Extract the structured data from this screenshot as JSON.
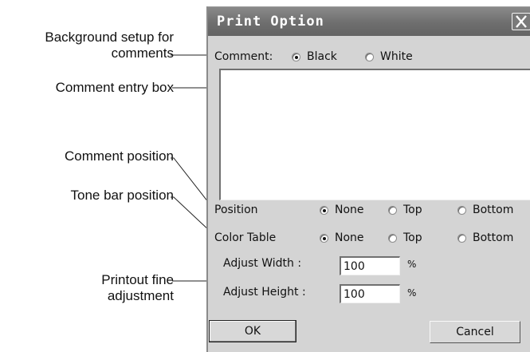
{
  "annotations": {
    "background_setup_line1": "Background setup for",
    "background_setup_line2": "comments",
    "comment_entry_box": "Comment entry box",
    "comment_position": "Comment position",
    "tone_bar_position": "Tone bar position",
    "printout_line1": "Printout fine",
    "printout_line2": "adjustment"
  },
  "dialog": {
    "title": "Print Option",
    "comment": {
      "label": "Comment:",
      "options": [
        "Black",
        "White"
      ],
      "selected": "Black",
      "text": ""
    },
    "position": {
      "label": "Position",
      "options": [
        "None",
        "Top",
        "Bottom"
      ],
      "selected": "None"
    },
    "color_table": {
      "label": "Color Table",
      "options": [
        "None",
        "Top",
        "Bottom"
      ],
      "selected": "None"
    },
    "adjust_width": {
      "label": "Adjust Width :",
      "value": "100",
      "unit": "%"
    },
    "adjust_height": {
      "label": "Adjust Height :",
      "value": "100",
      "unit": "%"
    },
    "ok_label": "OK",
    "cancel_label": "Cancel"
  },
  "colors": {
    "titlebar": "#707070",
    "dialog_bg": "#d4d4d4",
    "annotation_text": "#111111"
  }
}
